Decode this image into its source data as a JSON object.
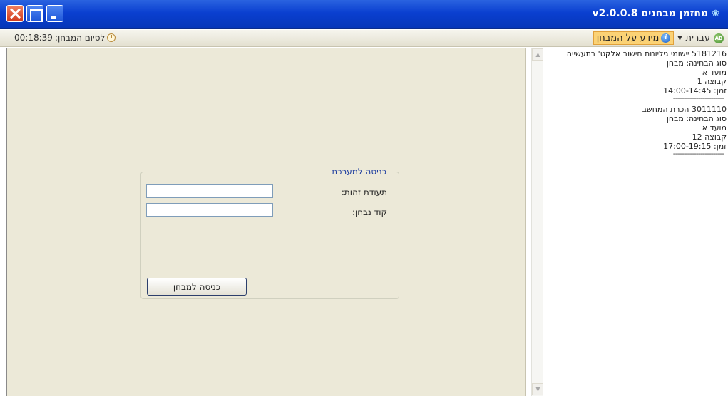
{
  "window": {
    "title": "מחזמן מבחנים v2.0.0.8",
    "close_label": "close",
    "maximize_label": "maximize",
    "minimize_label": "minimize"
  },
  "toolbar": {
    "timer_label": "לסיום המבחן:",
    "timer_value": "00:18:39",
    "language_label": "עברית",
    "exam_info_label": "מידע על המבחן"
  },
  "login": {
    "group_title": "כניסה למערכת",
    "id_label": "תעודת זהות:",
    "id_value": "",
    "code_label": "קוד נבחן:",
    "code_value": "",
    "submit_label": "כניסה למבחן"
  },
  "exams": [
    {
      "title": "5181216 יישומי גיליונות חישוב אלקט' בתעשייה",
      "type": "סוג הבחינה: מבחן",
      "session": "מועד א",
      "group": "קבוצה 1",
      "time": "זמן: 14:00-14:45",
      "separator": "------------------------"
    },
    {
      "title": "3011110 הכרת המחשב",
      "type": "סוג הבחינה: מבחן",
      "session": "מועד א",
      "group": "קבוצה 12",
      "time": "זמן: 17:00-19:15",
      "separator": "------------------------"
    }
  ],
  "colors": {
    "titlebar": "#0a3fd0",
    "toolbar": "#ece9d8",
    "info_button": "#fbd275",
    "legend_text": "#1f3fa0"
  },
  "icons": {
    "app": "app-logo-icon",
    "clock": "clock-icon",
    "language": "language-icon",
    "info": "info-icon"
  }
}
